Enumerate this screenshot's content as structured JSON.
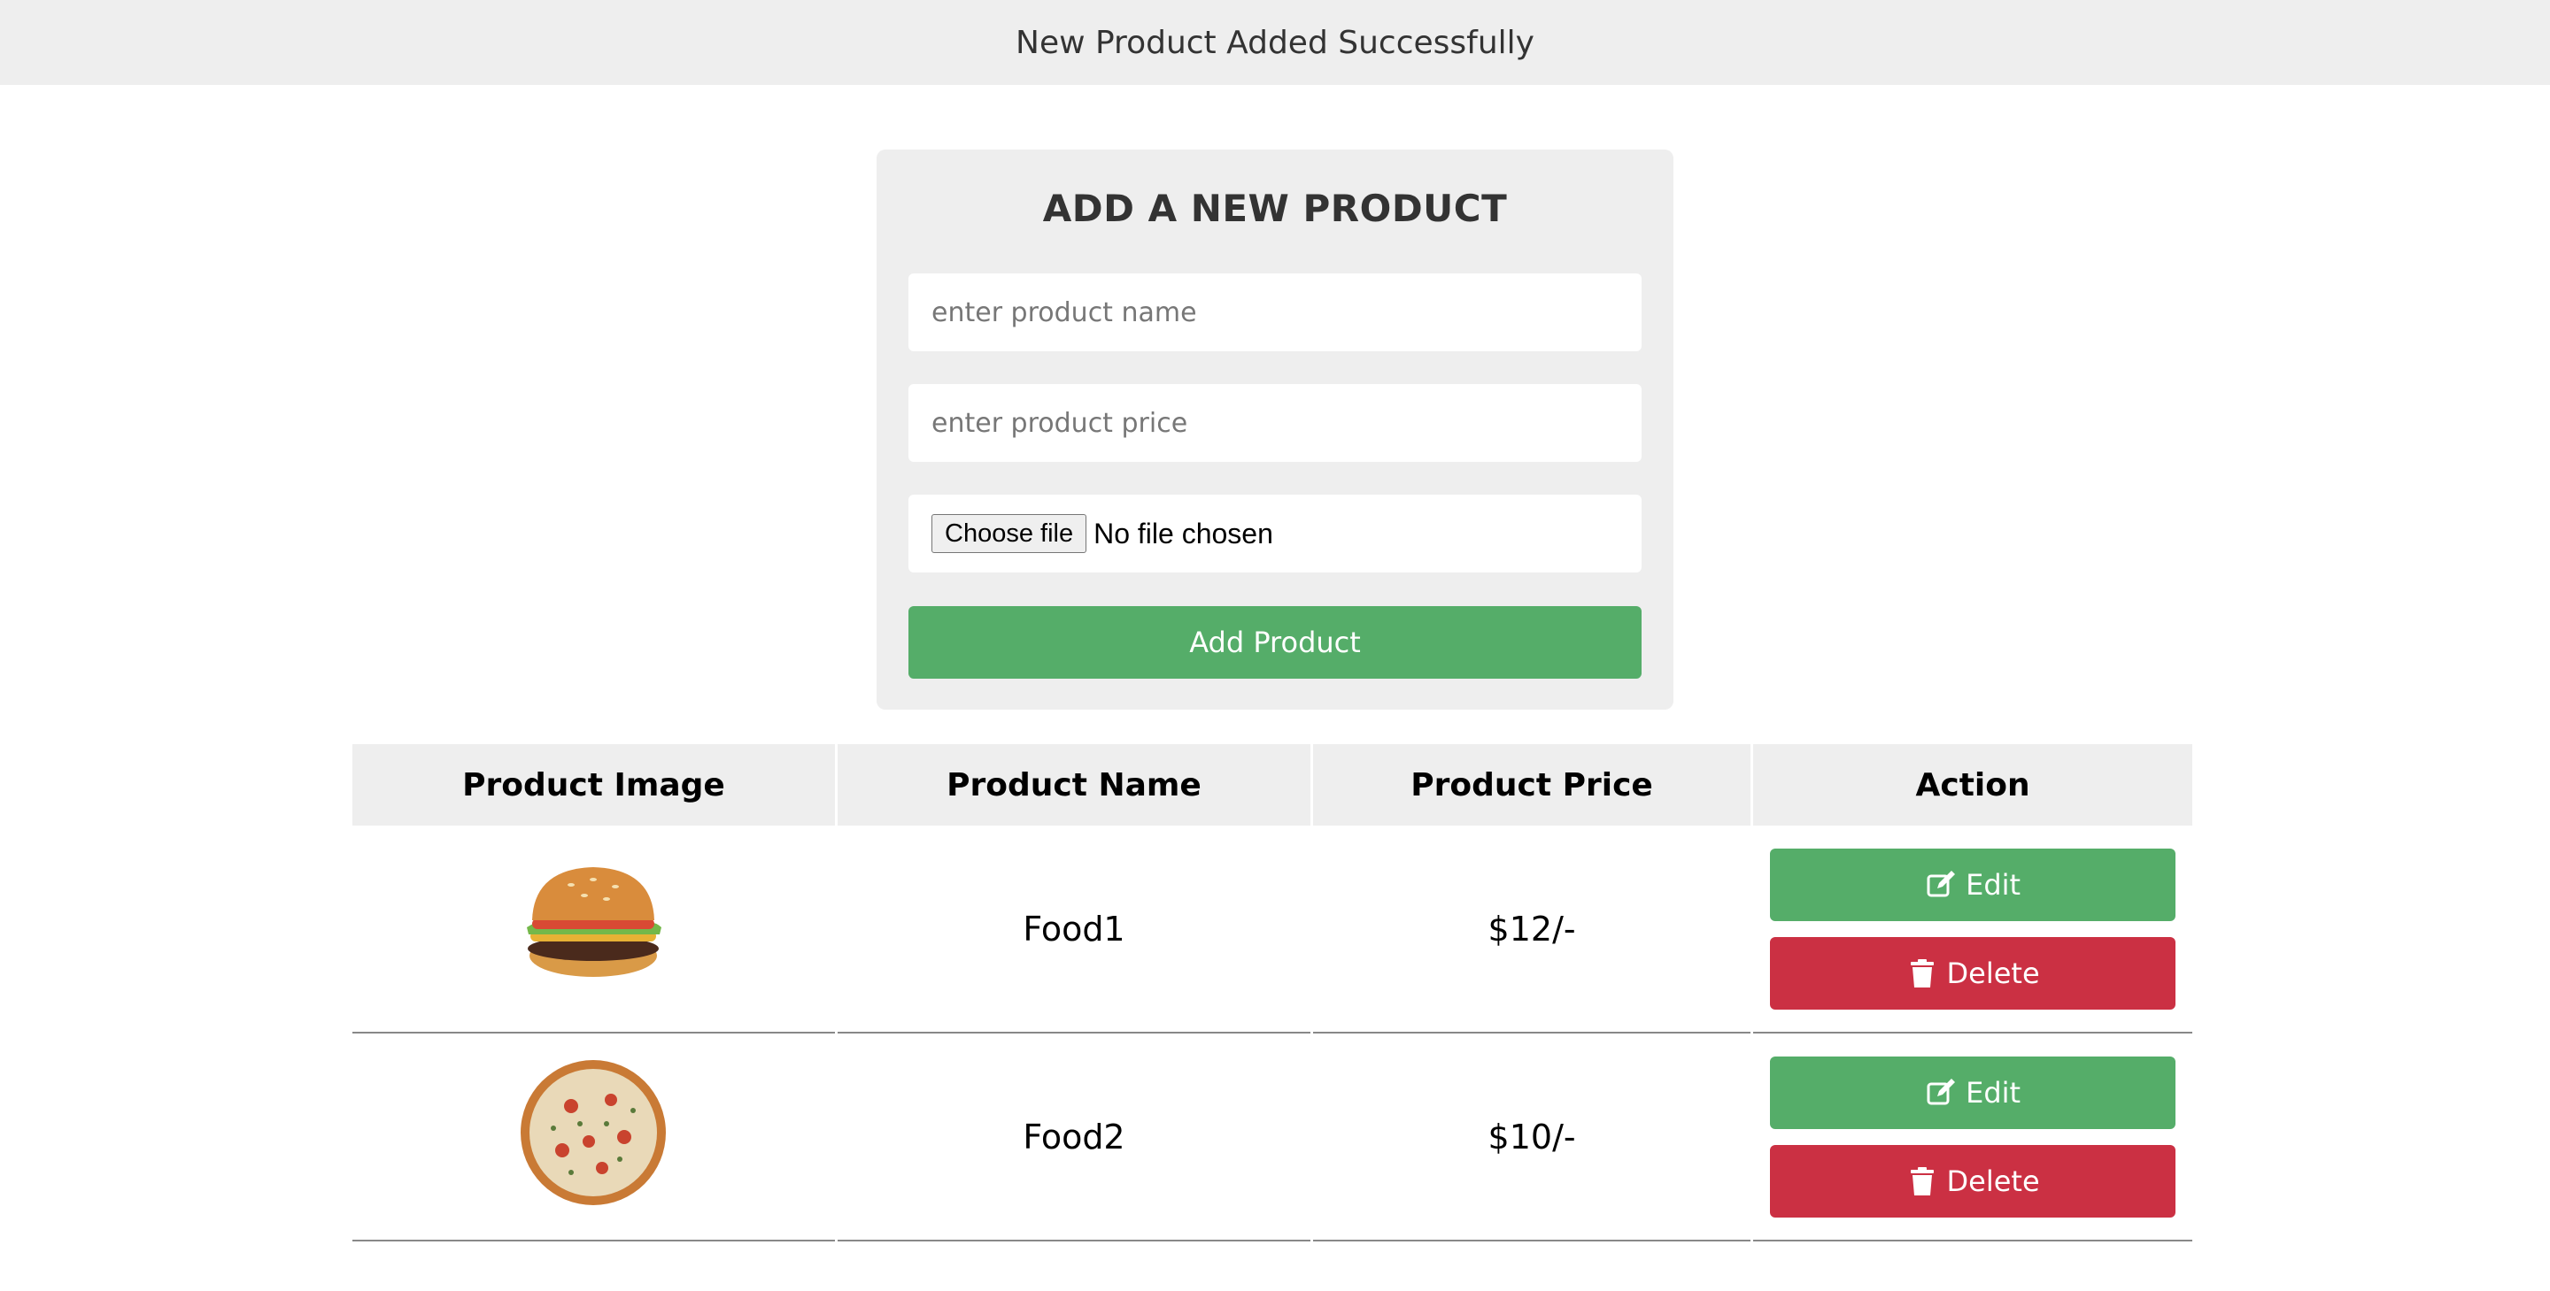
{
  "banner": {
    "message": "New Product Added Successfully"
  },
  "form": {
    "title": "ADD A NEW PRODUCT",
    "name_placeholder": "enter product name",
    "price_placeholder": "enter product price",
    "file_button_label": "Choose file",
    "file_status": "No file chosen",
    "submit_label": "Add Product"
  },
  "table": {
    "headers": [
      "Product Image",
      "Product Name",
      "Product Price",
      "Action"
    ],
    "rows": [
      {
        "image": "burger-image",
        "name": "Food1",
        "price": "$12/-",
        "edit_label": "Edit",
        "delete_label": "Delete"
      },
      {
        "image": "pizza-image",
        "name": "Food2",
        "price": "$10/-",
        "edit_label": "Edit",
        "delete_label": "Delete"
      }
    ]
  },
  "colors": {
    "edit": "#55ad69",
    "delete": "#cb3043",
    "panel": "#eeeeee"
  },
  "icons": {
    "edit": "edit-pencil-square-icon",
    "delete": "trash-icon"
  }
}
